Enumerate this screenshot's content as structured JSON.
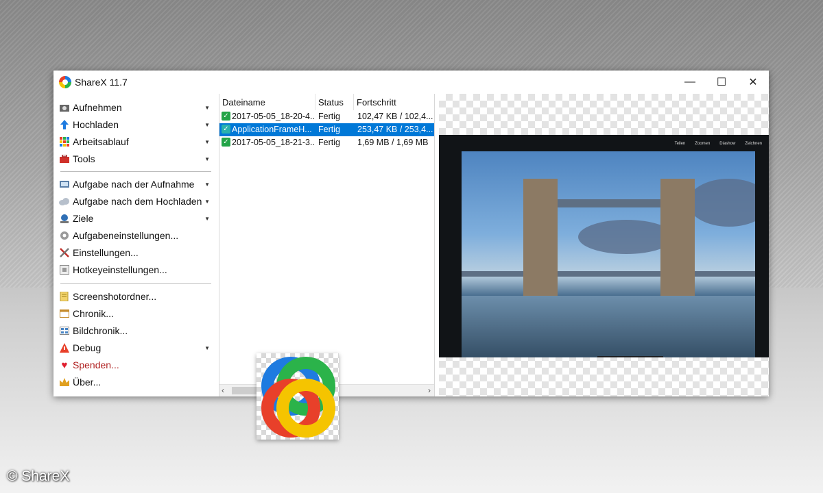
{
  "window": {
    "title": "ShareX 11.7",
    "minimize": "—",
    "maximize": "☐",
    "close": "✕"
  },
  "menu": {
    "group1": [
      {
        "label": "Aufnehmen",
        "icon": "camera-icon",
        "has_submenu": true
      },
      {
        "label": "Hochladen",
        "icon": "upload-arrow-icon",
        "has_submenu": true
      },
      {
        "label": "Arbeitsablauf",
        "icon": "workflow-grid-icon",
        "has_submenu": true
      },
      {
        "label": "Tools",
        "icon": "toolbox-icon",
        "has_submenu": true
      }
    ],
    "group2": [
      {
        "label": "Aufgabe nach der Aufnahme",
        "icon": "after-capture-icon",
        "has_submenu": true
      },
      {
        "label": "Aufgabe nach dem Hochladen",
        "icon": "cloud-icon",
        "has_submenu": true
      },
      {
        "label": "Ziele",
        "icon": "destinations-icon",
        "has_submenu": true
      },
      {
        "label": "Aufgabeneinstellungen...",
        "icon": "gear-icon",
        "has_submenu": false
      },
      {
        "label": "Einstellungen...",
        "icon": "wrench-screwdriver-icon",
        "has_submenu": false
      },
      {
        "label": "Hotkeyeinstellungen...",
        "icon": "keyboard-icon",
        "has_submenu": false
      }
    ],
    "group3": [
      {
        "label": "Screenshotordner...",
        "icon": "folder-icon",
        "has_submenu": false
      },
      {
        "label": "Chronik...",
        "icon": "history-icon",
        "has_submenu": false
      },
      {
        "label": "Bildchronik...",
        "icon": "image-history-icon",
        "has_submenu": false
      },
      {
        "label": "Debug",
        "icon": "warning-icon",
        "has_submenu": true
      },
      {
        "label": "Spenden...",
        "icon": "heart-icon",
        "has_submenu": false
      },
      {
        "label": "Über...",
        "icon": "crown-icon",
        "has_submenu": false
      }
    ]
  },
  "file_list": {
    "columns": [
      "Dateiname",
      "Status",
      "Fortschritt"
    ],
    "rows": [
      {
        "name": "2017-05-05_18-20-4...",
        "status": "Fertig",
        "progress": "102,47 KB / 102,4...",
        "selected": false
      },
      {
        "name": "ApplicationFrameH...",
        "status": "Fertig",
        "progress": "253,47 KB / 253,4...",
        "selected": true
      },
      {
        "name": "2017-05-05_18-21-3...",
        "status": "Fertig",
        "progress": "1,69 MB / 1,69 MB",
        "selected": false
      }
    ]
  },
  "preview": {
    "toolbar": [
      "Teilen",
      "Zoomen",
      "Diashow",
      "Zeichnen"
    ]
  },
  "copyright": "© ShareX",
  "colors": {
    "selection": "#0078d7",
    "check_green": "#22a447",
    "logo_blue": "#1e7be0",
    "logo_green": "#2bb34a",
    "logo_yellow": "#f5c400",
    "logo_red": "#e8402a"
  }
}
